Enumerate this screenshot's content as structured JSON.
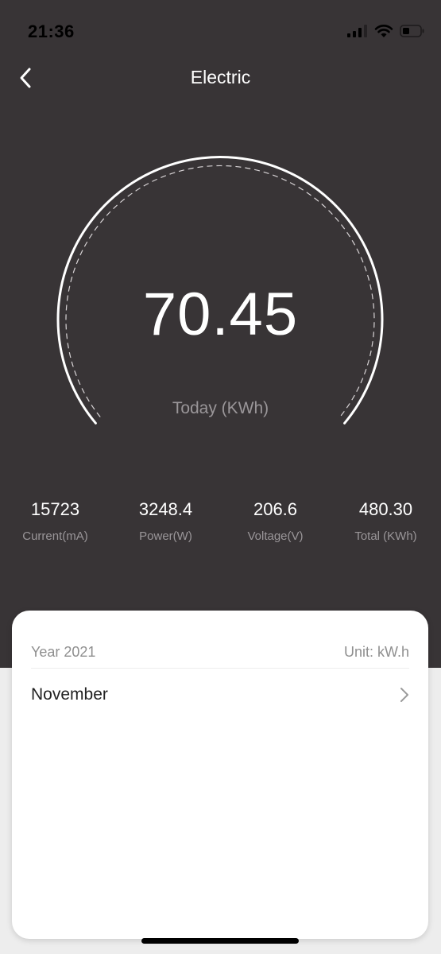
{
  "status_bar": {
    "time": "21:36",
    "icons": [
      "signal-icon",
      "wifi-icon",
      "battery-icon"
    ]
  },
  "header": {
    "title": "Electric",
    "back_icon": "chevron-left-icon"
  },
  "gauge": {
    "value": "70.45",
    "label": "Today (KWh)"
  },
  "stats": [
    {
      "value": "15723",
      "label": "Current(mA)"
    },
    {
      "value": "3248.4",
      "label": "Power(W)"
    },
    {
      "value": "206.6",
      "label": "Voltage(V)"
    },
    {
      "value": "480.30",
      "label": "Total (KWh)"
    }
  ],
  "history": {
    "year_label": "Year 2021",
    "unit_label": "Unit: kW.h",
    "rows": [
      {
        "label": "November",
        "icon": "chevron-right-icon"
      }
    ]
  },
  "colors": {
    "background_dark": "#383436",
    "card": "#ffffff",
    "text_primary": "#ffffff",
    "text_secondary": "#9a9699"
  }
}
